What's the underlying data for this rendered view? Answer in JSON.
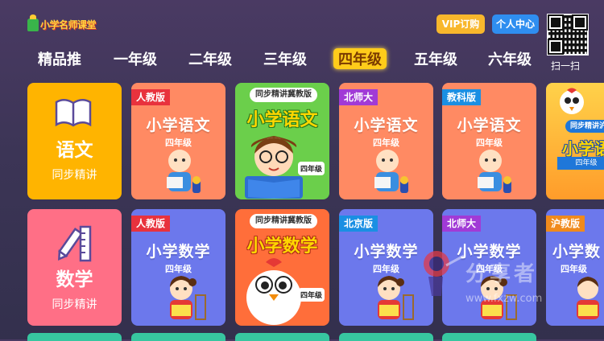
{
  "header": {
    "logo_text": "小学名师课堂",
    "vip_label": "VIP订购",
    "account_label": "个人中心",
    "scan_label": "扫一扫"
  },
  "tabs": [
    {
      "label": "精品推"
    },
    {
      "label": "一年级"
    },
    {
      "label": "二年级"
    },
    {
      "label": "三年级"
    },
    {
      "label": "四年级"
    },
    {
      "label": "五年级"
    },
    {
      "label": "六年级"
    }
  ],
  "rows": [
    {
      "subject": {
        "name": "语文",
        "sub": "同步精讲",
        "color": "#ffb400"
      },
      "courses": [
        {
          "tag": "人教版",
          "title": "小学语文",
          "grade": "四年级",
          "bg": "#ff8a63",
          "tagColor": "#e8323d"
        },
        {
          "head": "同步精讲冀教版",
          "big": "小学语文",
          "badge": "四年级",
          "bg": "#6bcf4b"
        },
        {
          "tag": "北师大",
          "title": "小学语文",
          "grade": "四年级",
          "bg": "#ff8a63",
          "tagColor": "#a13ad6"
        },
        {
          "tag": "教科版",
          "title": "小学语文",
          "grade": "四年级",
          "bg": "#ff8a63",
          "tagColor": "#1a8fe3"
        },
        {
          "head": "同步精讲沪",
          "big": "小学语",
          "badge": "四年级"
        }
      ]
    },
    {
      "subject": {
        "name": "数学",
        "sub": "同步精讲",
        "color": "#ff6f86"
      },
      "courses": [
        {
          "tag": "人教版",
          "title": "小学数学",
          "grade": "四年级",
          "bg": "#6c78ec",
          "tagColor": "#e8323d"
        },
        {
          "head": "同步精讲冀教版",
          "big": "小学数学",
          "badge": "四年级",
          "bg": "#ff6e3a"
        },
        {
          "tag": "北京版",
          "title": "小学数学",
          "grade": "四年级",
          "bg": "#6c78ec",
          "tagColor": "#1a8fe3"
        },
        {
          "tag": "北师大",
          "title": "小学数学",
          "grade": "四年级",
          "bg": "#6c78ec",
          "tagColor": "#a13ad6"
        },
        {
          "tag": "沪教版",
          "title": "小学数",
          "grade": "四年级",
          "bg": "#6c78ec",
          "tagColor": "#f08a1c"
        }
      ]
    }
  ],
  "watermark": {
    "text": "分享者",
    "url": "www.fxzw.com"
  }
}
